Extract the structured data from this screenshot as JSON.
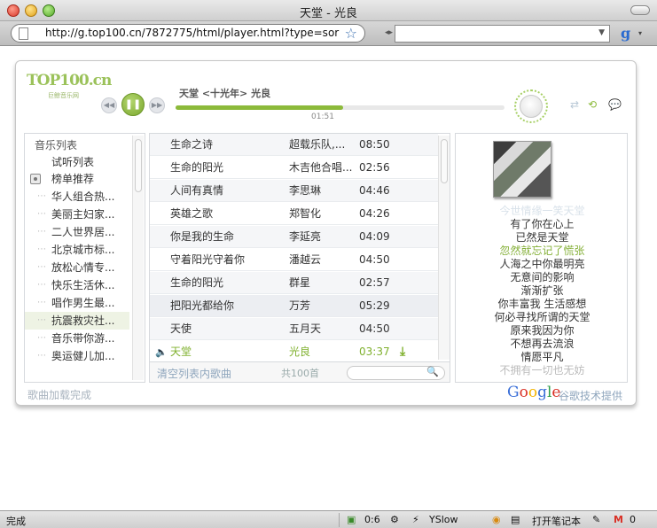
{
  "window": {
    "title": "天堂 - 光良",
    "url": "http://g.top100.cn/7872775/html/player.html?type=sor"
  },
  "player": {
    "logo_main": "TOP100.cn",
    "logo_sub": "巨鲸音乐网",
    "now_playing": "天堂  <十光年>  光良",
    "elapsed": "01:51",
    "progress_fraction": 0.51
  },
  "sidebar": {
    "title": "音乐列表",
    "items": [
      {
        "label": "试听列表",
        "level": "top"
      },
      {
        "label": "榜单推荐",
        "level": "top"
      },
      {
        "label": "华人组合热...",
        "level": "child"
      },
      {
        "label": "美丽主妇家...",
        "level": "child"
      },
      {
        "label": "二人世界居...",
        "level": "child"
      },
      {
        "label": "北京城市标...",
        "level": "child"
      },
      {
        "label": "放松心情专...",
        "level": "child"
      },
      {
        "label": "快乐生活休...",
        "level": "child"
      },
      {
        "label": "唱作男生最...",
        "level": "child"
      },
      {
        "label": "抗震救灾社...",
        "level": "child"
      },
      {
        "label": "音乐带你游...",
        "level": "child"
      },
      {
        "label": "奥运健儿加...",
        "level": "child"
      }
    ]
  },
  "songs": [
    {
      "title": "生命之诗",
      "artist": "超载乐队,...",
      "duration": "08:50"
    },
    {
      "title": "生命的阳光",
      "artist": "木吉他合唱...",
      "duration": "02:56"
    },
    {
      "title": "人间有真情",
      "artist": "李思琳",
      "duration": "04:46"
    },
    {
      "title": "英雄之歌",
      "artist": "郑智化",
      "duration": "04:26"
    },
    {
      "title": "你是我的生命",
      "artist": "李延亮",
      "duration": "04:09"
    },
    {
      "title": "守着阳光守着你",
      "artist": "潘越云",
      "duration": "04:50"
    },
    {
      "title": "生命的阳光",
      "artist": "群星",
      "duration": "02:57"
    },
    {
      "title": "把阳光都给你",
      "artist": "万芳",
      "duration": "05:29"
    },
    {
      "title": "天使",
      "artist": "五月天",
      "duration": "04:50"
    },
    {
      "title": "天堂",
      "artist": "光良",
      "duration": "03:37"
    }
  ],
  "list_footer": {
    "clear_label": "清空列表内歌曲",
    "count": "共100首"
  },
  "lyrics": [
    "今世情缘一笑天堂",
    "有了你在心上",
    "已然是天堂",
    "忽然就忘记了慌张",
    "人海之中你最明亮",
    "无意间的影响",
    "渐渐扩张",
    "你丰富我 生活感想",
    "何必寻找所谓的天堂",
    "原来我因为你",
    "不想再去流浪",
    "情愿平凡",
    "不拥有一切也无妨"
  ],
  "footer": {
    "load_status": "歌曲加载完成",
    "google_logo": "Google",
    "provided_by": "谷歌技术提供"
  },
  "statusbar": {
    "status": "完成",
    "counter": "0:6",
    "yslow": "YSlow",
    "notebook": "打开笔记本",
    "mail_count": "0"
  },
  "colors": {
    "accent_green": "#86b13a",
    "link_blue": "#8fa6bd"
  }
}
